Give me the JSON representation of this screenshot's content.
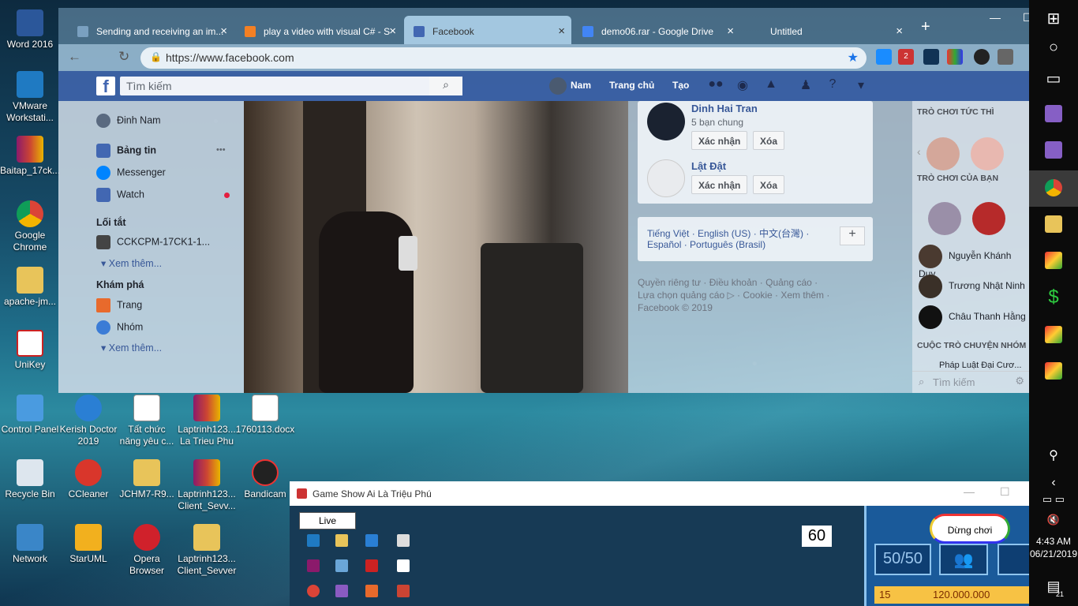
{
  "desktop": {
    "icons": [
      {
        "label": "Word 2016"
      },
      {
        "label": "VMware Workstati..."
      },
      {
        "label": "Baitap_17ck..."
      },
      {
        "label": "Google Chrome"
      },
      {
        "label": "apache-jm..."
      },
      {
        "label": "UniKey"
      },
      {
        "label": "Control Panel"
      },
      {
        "label": "Kerish Doctor 2019"
      },
      {
        "label": "Tất chức năng yêu c..."
      },
      {
        "label": "Laptrinh123... La Trieu Phu"
      },
      {
        "label": "1760113.docx"
      },
      {
        "label": "Recycle Bin"
      },
      {
        "label": "CCleaner"
      },
      {
        "label": "JCHM7-R9..."
      },
      {
        "label": "Laptrinh123... Client_Sevv..."
      },
      {
        "label": "Bandicam"
      },
      {
        "label": "Network"
      },
      {
        "label": "StarUML"
      },
      {
        "label": "Opera Browser"
      },
      {
        "label": "Laptrinh123... Client_Sevver"
      }
    ]
  },
  "browser": {
    "tabs": [
      {
        "title": "Sending and receiving an im..."
      },
      {
        "title": "play a video with visual C# - S"
      },
      {
        "title": "Facebook"
      },
      {
        "title": "demo06.rar - Google Drive"
      },
      {
        "title": "Untitled"
      }
    ],
    "new_tab": "+",
    "minimize": "—",
    "restore": "☐",
    "url": "https://www.facebook.com",
    "ext_badge": "2"
  },
  "facebook": {
    "logo": "f",
    "search_placeholder": "Tìm kiếm",
    "user": "Nam",
    "nav_home": "Trang chủ",
    "nav_create": "Tạo",
    "left": {
      "profile": "Đinh Nam",
      "feed": "Bảng tin",
      "messenger": "Messenger",
      "watch": "Watch",
      "shortcuts_header": "Lối tắt",
      "shortcut_group": "CCKCPM-17CK1-1...",
      "see_more_1": "Xem thêm...",
      "explore_header": "Khám phá",
      "pages": "Trang",
      "groups": "Nhóm",
      "see_more_2": "Xem thêm...",
      "more_dots": "•••"
    },
    "friend_requests": [
      {
        "name": "Dinh Hai Tran",
        "mutual": "5 bạn chung",
        "confirm": "Xác nhận",
        "delete": "Xóa"
      },
      {
        "name": "Lật Đật",
        "mutual": "",
        "confirm": "Xác nhận",
        "delete": "Xóa"
      }
    ],
    "languages": {
      "line1": "Tiếng Việt · English (US) · 中文(台灣) ·",
      "line2": "Español · Português (Brasil)",
      "add": "+"
    },
    "footer": {
      "line1": "Quyền riêng tư · Điều khoản · Quảng cáo ·",
      "line2": "Lựa chọn quảng cáo ▷ · Cookie · Xem thêm ·",
      "line3": "Facebook © 2019"
    },
    "chat": {
      "instant_games": "TRÒ CHƠI TỨC THÌ",
      "your_games": "TRÒ CHƠI CỦA BẠN",
      "contacts": [
        {
          "name": "Nguyễn Khánh Duy"
        },
        {
          "name": "Trương Nhật Ninh"
        },
        {
          "name": "Châu Thanh Hằng"
        }
      ],
      "group_header": "CUỘC TRÒ CHUYỆN NHÓM",
      "group_item": "Pháp Luật Đại Cươ...",
      "search_placeholder": "Tìm kiếm"
    }
  },
  "game": {
    "title": "Game Show Ai Là Triệu Phú",
    "live": "Live",
    "timer": "60",
    "stop": "Dừng chơi",
    "lifeline_5050": "50/50",
    "prize_level": "15",
    "prize_amount": "120.000.000",
    "minimize": "—",
    "maximize": "☐"
  },
  "taskbar": {
    "time": "4:43 AM",
    "date": "06/21/2019",
    "notifications": "21"
  },
  "colors": {
    "facebook_blue": "#4267b2",
    "link_blue": "#385898",
    "taskbar": "#0b0b0b"
  }
}
